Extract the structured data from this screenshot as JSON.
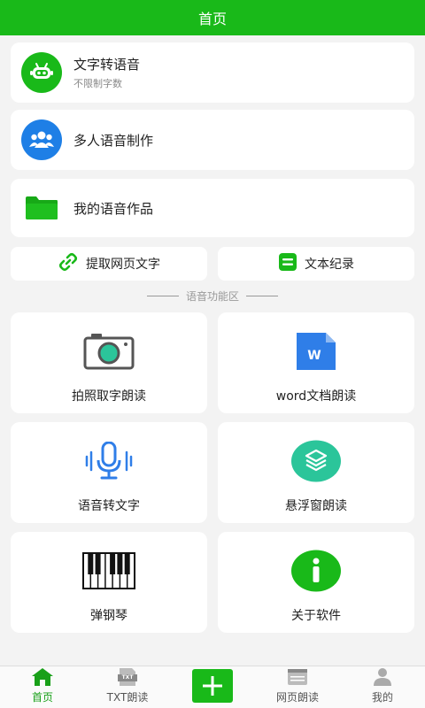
{
  "header": {
    "title": "首页"
  },
  "rows": [
    {
      "title": "文字转语音",
      "subtitle": "不限制字数"
    },
    {
      "title": "多人语音制作"
    },
    {
      "title": "我的语音作品"
    }
  ],
  "quick": [
    {
      "label": "提取网页文字"
    },
    {
      "label": "文本纪录"
    }
  ],
  "section": {
    "title": "语音功能区"
  },
  "grid": [
    {
      "label": "拍照取字朗读",
      "icon": "camera-icon"
    },
    {
      "label": "word文档朗读",
      "icon": "word-doc-icon"
    },
    {
      "label": "语音转文字",
      "icon": "microphone-icon"
    },
    {
      "label": "悬浮窗朗读",
      "icon": "layers-icon"
    },
    {
      "label": "弹钢琴",
      "icon": "piano-icon"
    },
    {
      "label": "关于软件",
      "icon": "info-icon"
    }
  ],
  "tabbar": [
    {
      "label": "首页"
    },
    {
      "label": "TXT朗读",
      "icon_text": "TXT"
    },
    {
      "label": "网页朗读"
    },
    {
      "label": "我的"
    }
  ],
  "colors": {
    "brand": "#19b919",
    "blue": "#1e7fe6",
    "word_blue": "#2f7ee8"
  }
}
